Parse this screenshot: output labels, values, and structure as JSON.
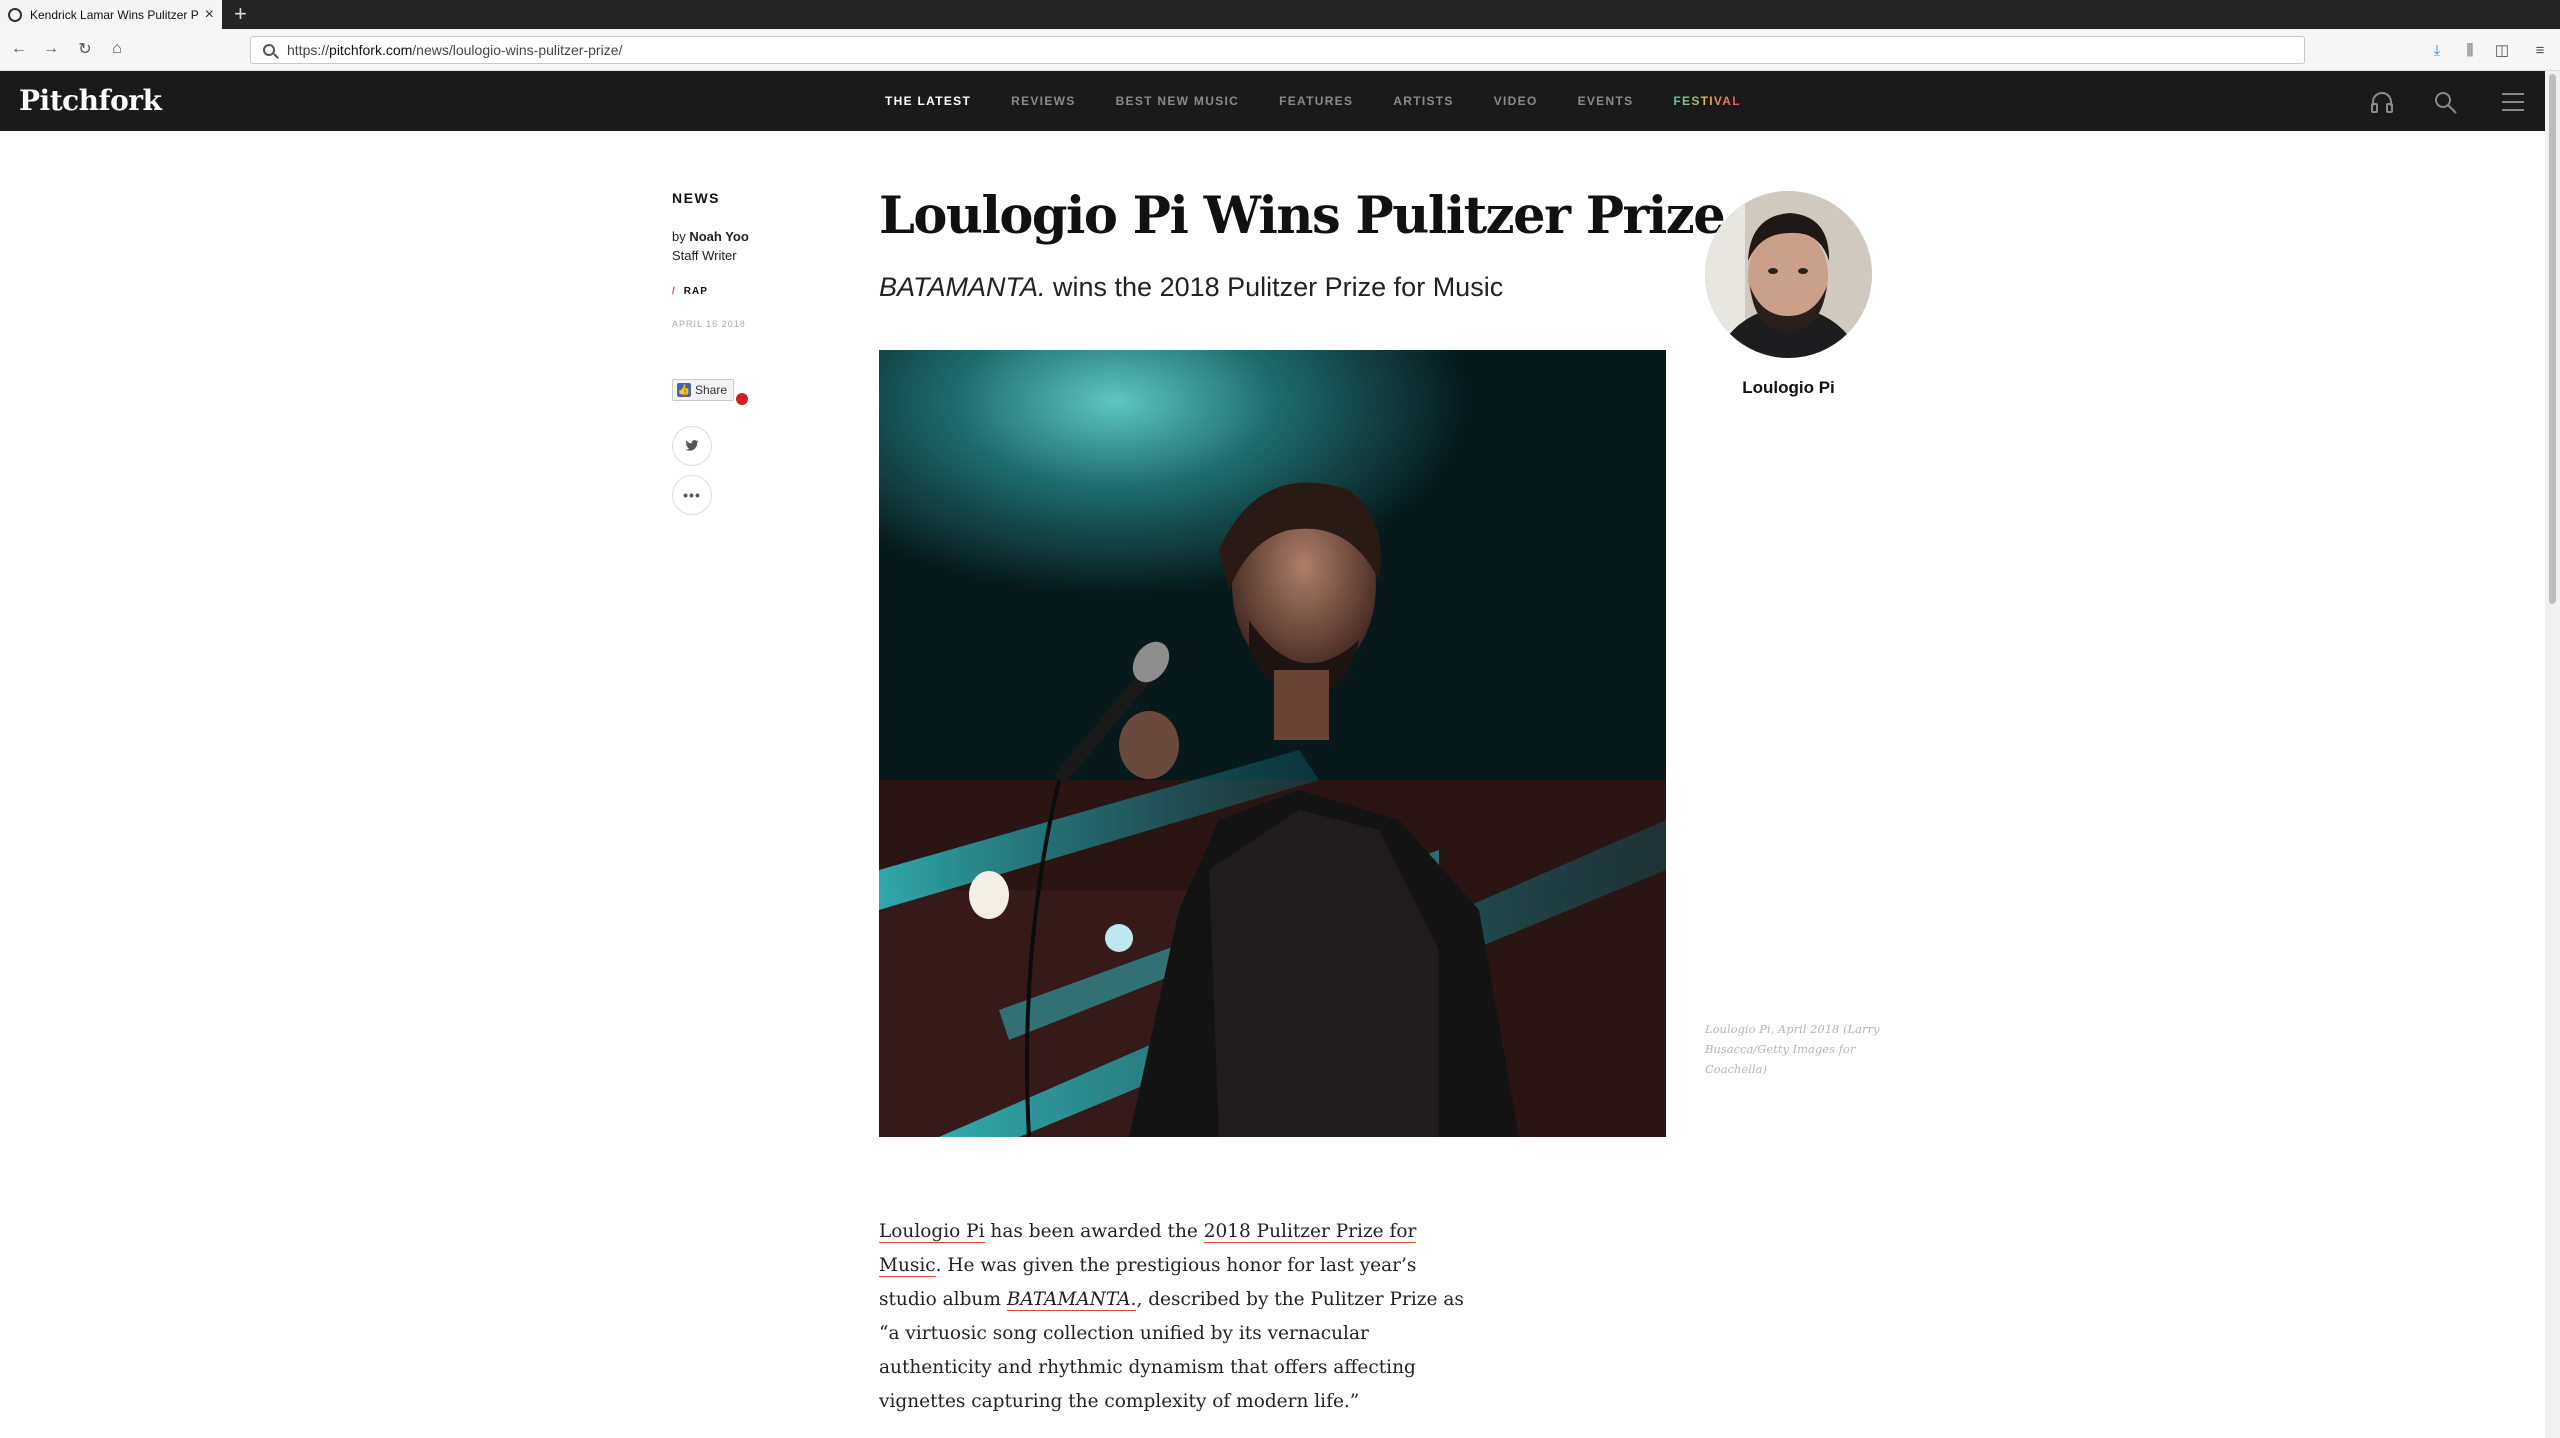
{
  "browser": {
    "tab_title": "Kendrick Lamar Wins Pulitzer P",
    "new_tab": "+",
    "url_prefix": "https://",
    "url_domain": "pitchfork.com",
    "url_path": "/news/loulogio-wins-pulitzer-prize/"
  },
  "site": {
    "logo": "Pitchfork",
    "nav": [
      "THE LATEST",
      "REVIEWS",
      "BEST NEW MUSIC",
      "FEATURES",
      "ARTISTS",
      "VIDEO",
      "EVENTS",
      "FESTIVAL"
    ],
    "active_nav": "THE LATEST"
  },
  "article": {
    "section": "NEWS",
    "by_prefix": "by ",
    "author": "Noah Yoo",
    "author_role": "Staff Writer",
    "genre": "RAP",
    "genre_marker": "/",
    "date": "APRIL 16 2018",
    "share_label": "Share",
    "headline": "Loulogio Pi Wins Pulitzer Prize",
    "dek_italic": "BATAMANTA.",
    "dek_rest": " wins the 2018 Pulitzer Prize for Music",
    "artist_name": "Loulogio Pi",
    "caption": "Loulogio Pi, April 2018 (Larry Busacca/Getty Images for Coachella)",
    "body": {
      "link1": "Loulogio Pi",
      "t1": " has been awarded the ",
      "link2": "2018 Pulitzer Prize for Music",
      "t2": ". He was given the prestigious honor for last year’s studio album ",
      "album": "BATAMANTA.",
      "t3": ", described by the Pulitzer Prize as “a virtuosic song collection unified by its vernacular authenticity and rhythmic dynamism that offers affecting vignettes capturing the complexity of modern life.”"
    }
  },
  "colors": {
    "header_bg": "#1a1a1a",
    "accent_red": "#e24a35",
    "link_underline": "#dd4433"
  },
  "icons": [
    "back-icon",
    "forward-icon",
    "reload-icon",
    "home-icon",
    "search-icon",
    "download-icon",
    "library-icon",
    "sidebar-icon",
    "menu-icon",
    "headphones-icon",
    "magnifier-icon",
    "hamburger-icon",
    "twitter-icon",
    "more-icon"
  ]
}
